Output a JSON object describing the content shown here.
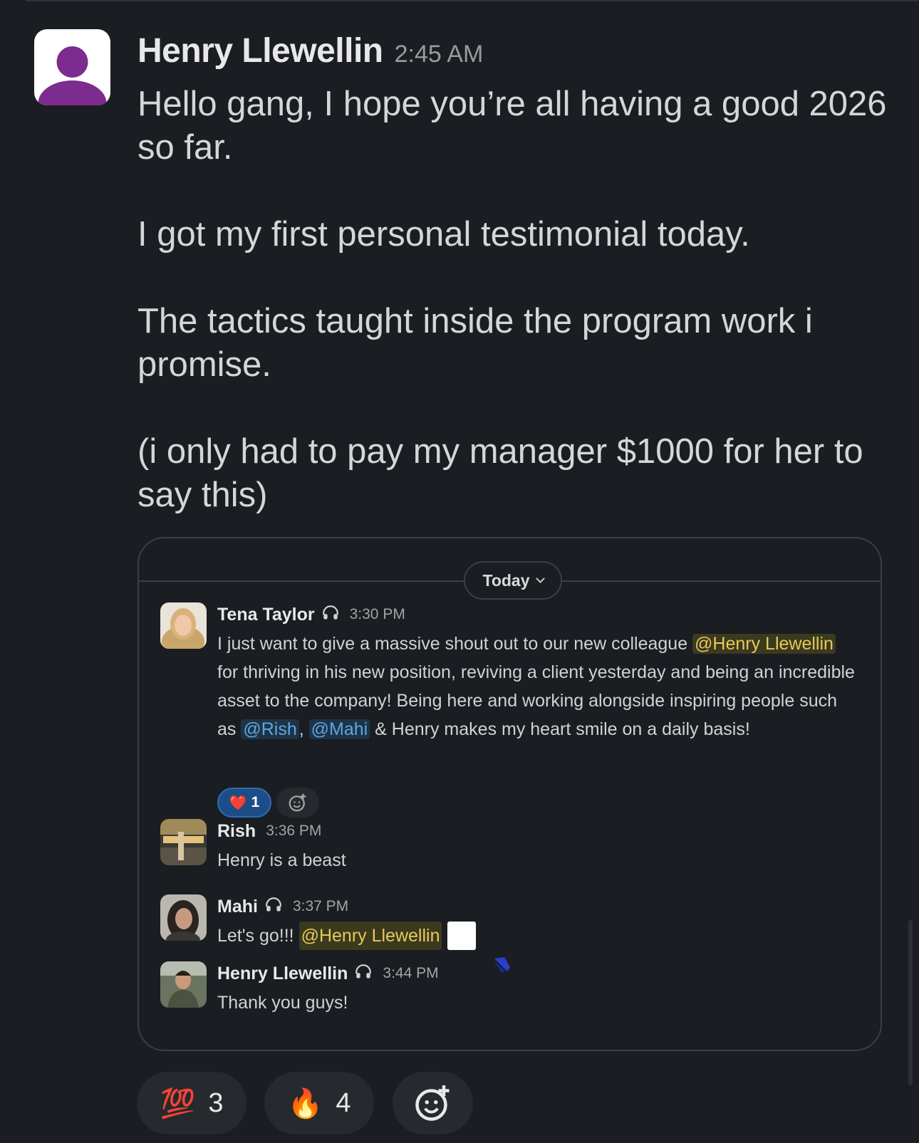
{
  "post": {
    "author": "Henry Llewellin",
    "time": "2:45 AM",
    "paragraphs": [
      "Hello gang, I hope you’re all having a good 2026 so far.",
      "I got my first personal testimonial today.",
      "The tactics taught inside the program work i promise.",
      "(i only had to pay my manager $1000 for her to say this)"
    ],
    "avatar_icon": "default-user-icon",
    "avatar_color": "#7c2b8f"
  },
  "embed": {
    "date_label": "Today",
    "messages": [
      {
        "name": "Tena Taylor",
        "time": "3:30 PM",
        "text_before": "I just want to give a massive shout out to our new colleague ",
        "mention": "@Henry Llewellin",
        "text_mid": " for thriving in his new position, reviving a client yesterday and being an incredible asset to the company! Being here and working alongside inspiring people such as ",
        "mention2": "@Rish",
        "sep": ", ",
        "mention3": "@Mahi",
        "text_after": " & Henry makes my heart smile on a daily basis!",
        "reaction": {
          "emoji": "❤️",
          "count": "1"
        }
      },
      {
        "name": "Rish",
        "time": "3:36 PM",
        "text": "Henry is a beast"
      },
      {
        "name": "Mahi",
        "time": "3:37 PM",
        "text": "Let's go!!! ",
        "mention": "@Henry Llewellin"
      },
      {
        "name": "Henry Llewellin",
        "time": "3:44 PM",
        "text": "Thank you guys!"
      }
    ]
  },
  "reactions": [
    {
      "emoji": "💯",
      "count": "3"
    },
    {
      "emoji": "🔥",
      "count": "4"
    },
    {
      "icon": "add-reaction-icon"
    }
  ],
  "colors": {
    "background": "#1a1d21",
    "mention_yellow_bg": "#3b3a1e",
    "mention_yellow_fg": "#e6c95b",
    "mention_blue_bg": "#1e3446",
    "mention_blue_fg": "#5ba7e6",
    "reaction_active": "#1d4d87"
  }
}
